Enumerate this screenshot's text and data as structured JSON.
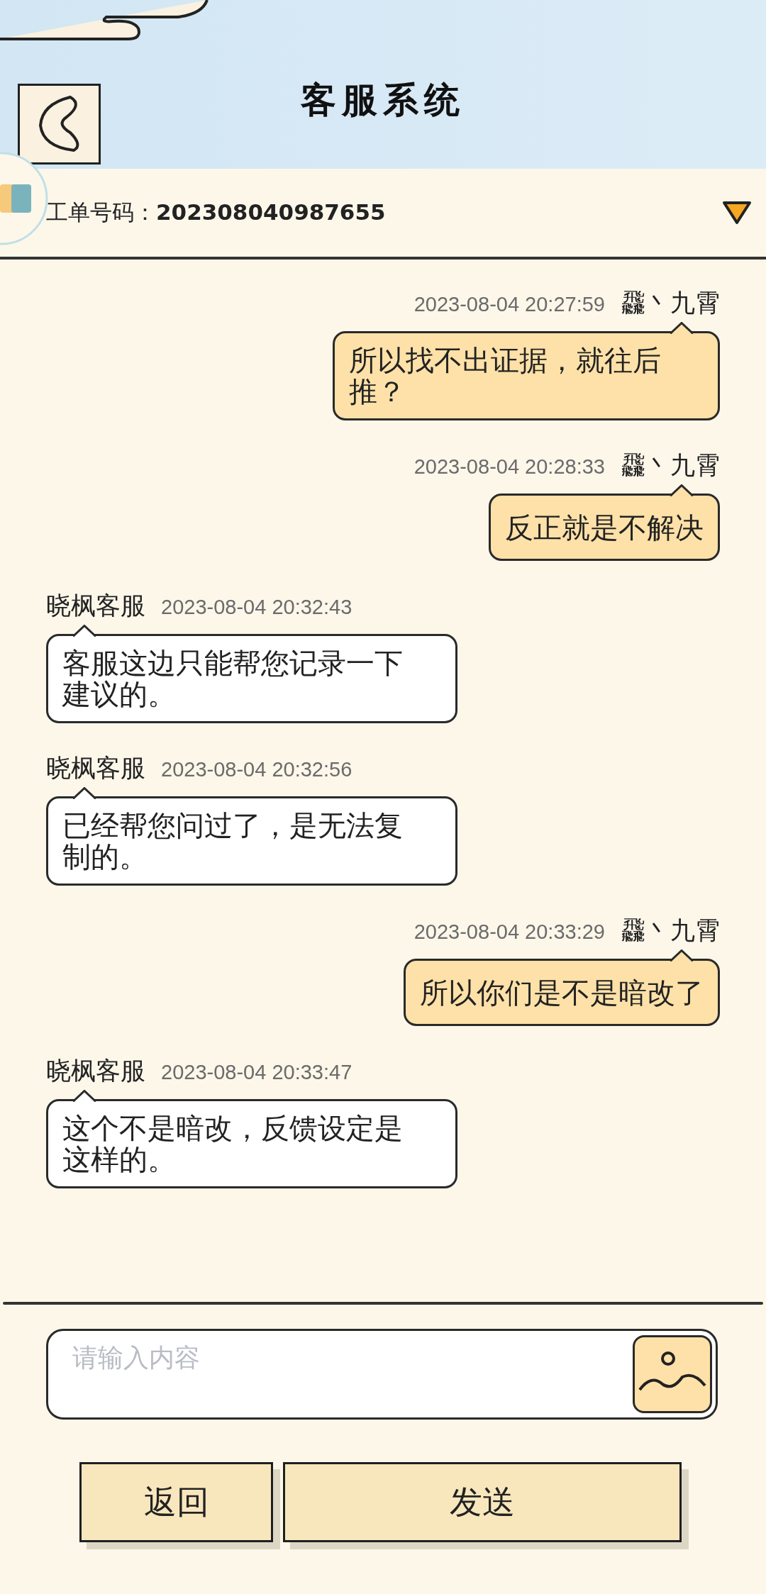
{
  "header": {
    "title": "客服系统"
  },
  "ticket": {
    "label": "工单号码：",
    "number": "202308040987655"
  },
  "messages": [
    {
      "kind": "sent",
      "sender": "飝丶九霄",
      "time": "2023-08-04 20:27:59",
      "text": "所以找不出证据，就往后推？"
    },
    {
      "kind": "sent",
      "sender": "飝丶九霄",
      "time": "2023-08-04 20:28:33",
      "text": "反正就是不解决"
    },
    {
      "kind": "received",
      "sender": "晓枫客服",
      "time": "2023-08-04 20:32:43",
      "text": "客服这边只能帮您记录一下建议的。"
    },
    {
      "kind": "received",
      "sender": "晓枫客服",
      "time": "2023-08-04 20:32:56",
      "text": "已经帮您问过了，是无法复制的。"
    },
    {
      "kind": "sent",
      "sender": "飝丶九霄",
      "time": "2023-08-04 20:33:29",
      "text": "所以你们是不是暗改了"
    },
    {
      "kind": "received",
      "sender": "晓枫客服",
      "time": "2023-08-04 20:33:47",
      "text": "这个不是暗改，反馈设定是这样的。"
    }
  ],
  "input": {
    "placeholder": "请输入内容"
  },
  "buttons": [
    {
      "label": "返回"
    },
    {
      "label": "发送"
    }
  ]
}
